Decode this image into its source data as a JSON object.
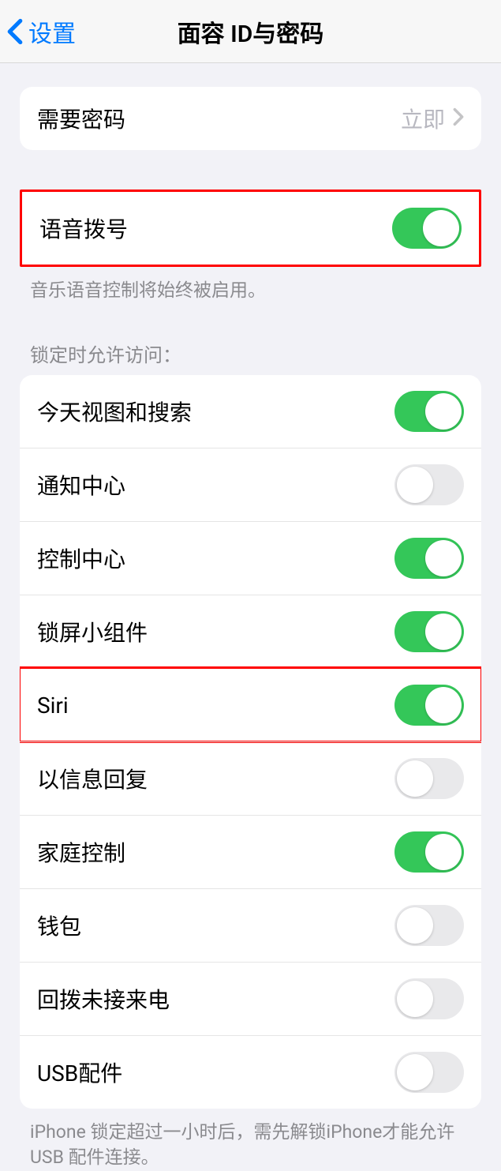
{
  "header": {
    "back_label": "设置",
    "title": "面容 ID与密码"
  },
  "passcode_group": {
    "require_passcode_label": "需要密码",
    "require_passcode_value": "立即"
  },
  "voice_dial_group": {
    "voice_dial_label": "语音拨号",
    "voice_dial_on": true
  },
  "voice_dial_footer": "音乐语音控制将始终被启用。",
  "locked_access_header": "锁定时允许访问：",
  "locked_access": [
    {
      "label": "今天视图和搜索",
      "on": true
    },
    {
      "label": "通知中心",
      "on": false
    },
    {
      "label": "控制中心",
      "on": true
    },
    {
      "label": "锁屏小组件",
      "on": true
    },
    {
      "label": "Siri",
      "on": true,
      "highlight": true
    },
    {
      "label": "以信息回复",
      "on": false
    },
    {
      "label": "家庭控制",
      "on": true
    },
    {
      "label": "钱包",
      "on": false
    },
    {
      "label": "回拨未接来电",
      "on": false
    },
    {
      "label": "USB配件",
      "on": false
    }
  ],
  "usb_footer": "iPhone 锁定超过一小时后，需先解锁iPhone才能允许USB 配件连接。"
}
